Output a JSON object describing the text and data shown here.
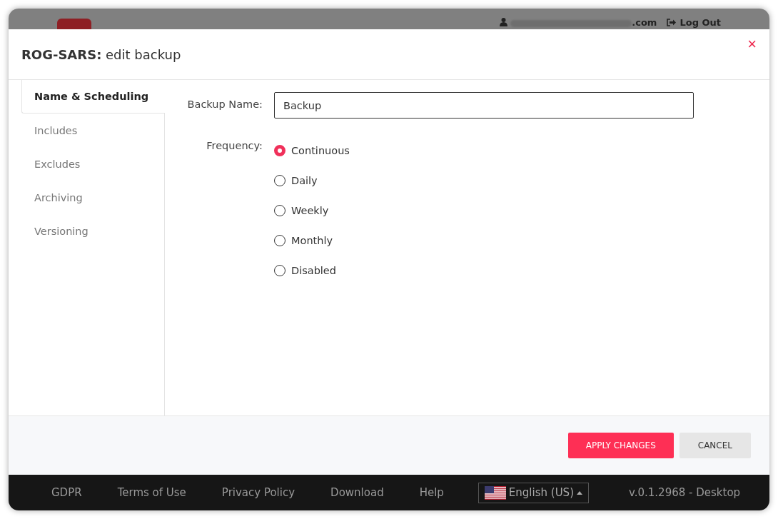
{
  "app_header": {
    "user_email_suffix": ".com",
    "logout_label": "Log Out"
  },
  "dialog": {
    "title_bold": "ROG-SARS:",
    "title_rest": "edit backup",
    "close_label": "×",
    "tabs": [
      {
        "label": "Name & Scheduling",
        "selected": true
      },
      {
        "label": "Includes",
        "selected": false
      },
      {
        "label": "Excludes",
        "selected": false
      },
      {
        "label": "Archiving",
        "selected": false
      },
      {
        "label": "Versioning",
        "selected": false
      }
    ],
    "backup_name": {
      "label": "Backup Name:",
      "value": "Backup"
    },
    "frequency": {
      "label": "Frequency:",
      "options": [
        {
          "label": "Continuous",
          "selected": true
        },
        {
          "label": "Daily",
          "selected": false
        },
        {
          "label": "Weekly",
          "selected": false
        },
        {
          "label": "Monthly",
          "selected": false
        },
        {
          "label": "Disabled",
          "selected": false
        }
      ]
    },
    "buttons": [
      {
        "label": "APPLY CHANGES",
        "kind": "primary"
      },
      {
        "label": "CANCEL",
        "kind": "secondary"
      }
    ]
  },
  "footer": {
    "links": [
      "GDPR",
      "Terms of Use",
      "Privacy Policy",
      "Download",
      "Help"
    ],
    "language": "English (US)",
    "version": "v.0.1.2968 - Desktop"
  }
}
